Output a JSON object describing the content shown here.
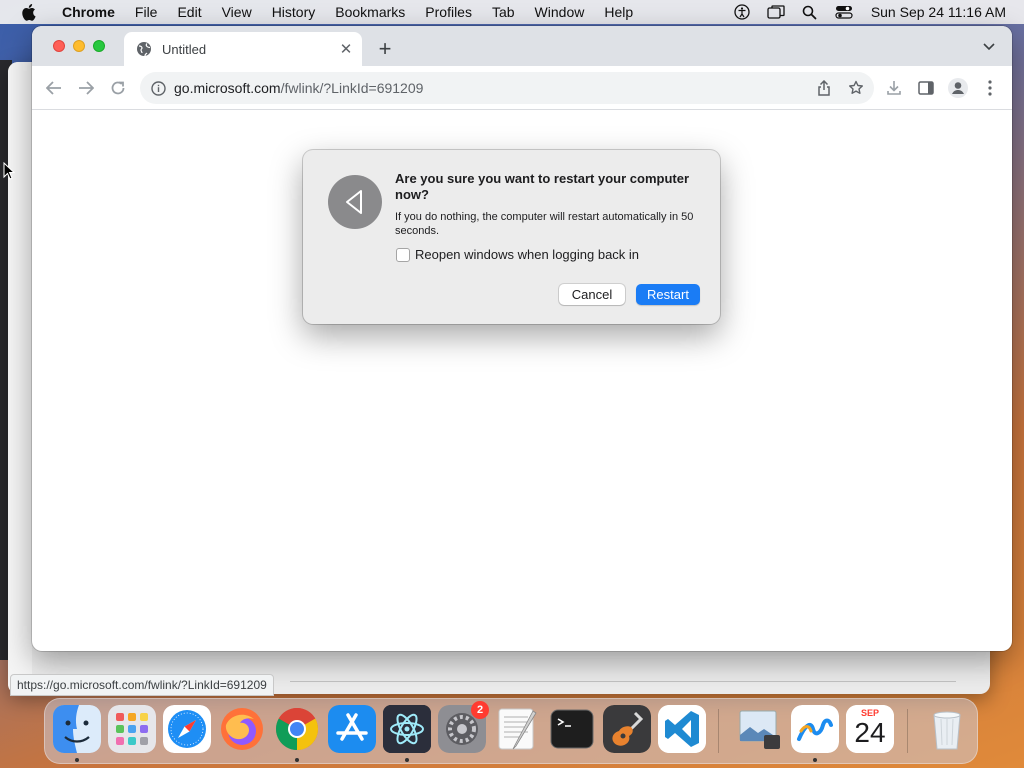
{
  "menubar": {
    "app_name": "Chrome",
    "items": [
      "File",
      "Edit",
      "View",
      "History",
      "Bookmarks",
      "Profiles",
      "Tab",
      "Window",
      "Help"
    ],
    "clock": "Sun Sep 24  11:16 AM"
  },
  "browser": {
    "tab_title": "Untitled",
    "url_host": "go.microsoft.com",
    "url_path": "/fwlink/?LinkId=691209",
    "status_url": "https://go.microsoft.com/fwlink/?LinkId=691209"
  },
  "dialog": {
    "title": "Are you sure you want to restart your computer now?",
    "message": "If you do nothing, the computer will restart automatically in 50 seconds.",
    "checkbox_label": "Reopen windows when logging back in",
    "checkbox_checked": false,
    "cancel_label": "Cancel",
    "restart_label": "Restart"
  },
  "dock": {
    "items": [
      "Finder",
      "Launchpad",
      "Safari",
      "Firefox",
      "Chrome",
      "App Store",
      "Electron",
      "System Preferences",
      "TextEdit",
      "Terminal",
      "GarageBand",
      "Visual Studio Code",
      "Preview",
      "Freeform",
      "Calendar",
      "Trash"
    ],
    "settings_badge": "2",
    "calendar_month": "SEP",
    "calendar_day": "24"
  },
  "colors": {
    "accent": "#1a7cf5",
    "traffic_red": "#ff5f57",
    "traffic_yellow": "#febc2e",
    "traffic_green": "#28c840"
  }
}
